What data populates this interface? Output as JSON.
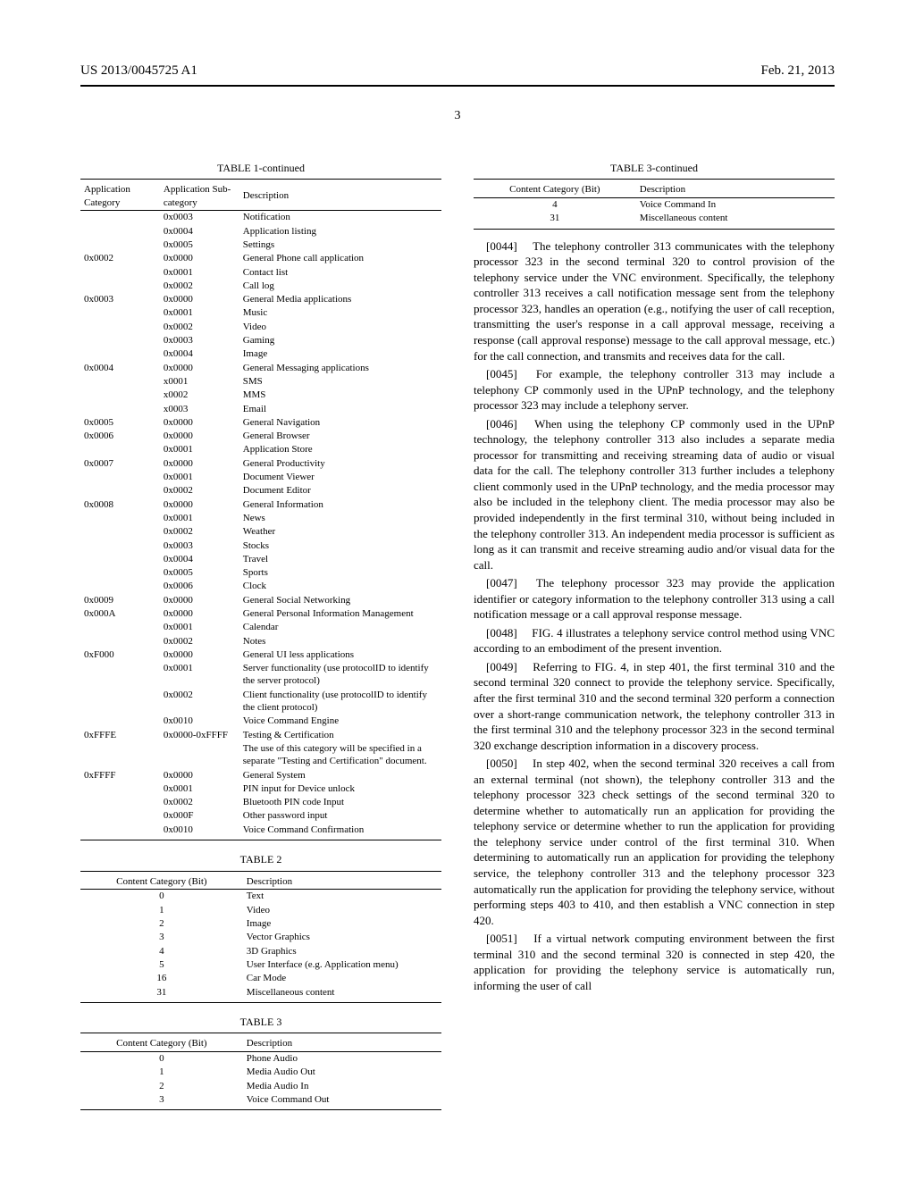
{
  "header": {
    "pub_number": "US 2013/0045725 A1",
    "pub_date": "Feb. 21, 2013",
    "page_number": "3"
  },
  "table1": {
    "title": "TABLE 1-continued",
    "headers": [
      "Application Category",
      "Application Sub-category",
      "Description"
    ],
    "rows": [
      [
        "",
        "0x0003",
        "Notification"
      ],
      [
        "",
        "0x0004",
        "Application listing"
      ],
      [
        "",
        "0x0005",
        "Settings"
      ],
      [
        "0x0002",
        "0x0000",
        "General Phone call application"
      ],
      [
        "",
        "0x0001",
        "Contact list"
      ],
      [
        "",
        "0x0002",
        "Call log"
      ],
      [
        "0x0003",
        "0x0000",
        "General Media applications"
      ],
      [
        "",
        "0x0001",
        "Music"
      ],
      [
        "",
        "0x0002",
        "Video"
      ],
      [
        "",
        "0x0003",
        "Gaming"
      ],
      [
        "",
        "0x0004",
        "Image"
      ],
      [
        "0x0004",
        "0x0000",
        "General Messaging applications"
      ],
      [
        "",
        "x0001",
        "SMS"
      ],
      [
        "",
        "x0002",
        "MMS"
      ],
      [
        "",
        "x0003",
        "Email"
      ],
      [
        "0x0005",
        "0x0000",
        "General Navigation"
      ],
      [
        "0x0006",
        "0x0000",
        "General Browser"
      ],
      [
        "",
        "0x0001",
        "Application Store"
      ],
      [
        "0x0007",
        "0x0000",
        "General Productivity"
      ],
      [
        "",
        "0x0001",
        "Document Viewer"
      ],
      [
        "",
        "0x0002",
        "Document Editor"
      ],
      [
        "0x0008",
        "0x0000",
        "General Information"
      ],
      [
        "",
        "0x0001",
        "News"
      ],
      [
        "",
        "0x0002",
        "Weather"
      ],
      [
        "",
        "0x0003",
        "Stocks"
      ],
      [
        "",
        "0x0004",
        "Travel"
      ],
      [
        "",
        "0x0005",
        "Sports"
      ],
      [
        "",
        "0x0006",
        "Clock"
      ],
      [
        "0x0009",
        "0x0000",
        "General Social Networking"
      ],
      [
        "0x000A",
        "0x0000",
        "General Personal Information Management"
      ],
      [
        "",
        "0x0001",
        "Calendar"
      ],
      [
        "",
        "0x0002",
        "Notes"
      ],
      [
        "0xF000",
        "0x0000",
        "General UI less applications"
      ],
      [
        "",
        "0x0001",
        "Server functionality (use protocolID to identify the server protocol)"
      ],
      [
        "",
        "0x0002",
        "Client functionality (use protocolID to identify the client protocol)"
      ],
      [
        "",
        "0x0010",
        "Voice Command Engine"
      ],
      [
        "0xFFFE",
        "0x0000-0xFFFF",
        "Testing & Certification"
      ],
      [
        "",
        "",
        "The use of this category will be specified in a separate \"Testing and Certification\" document."
      ],
      [
        "0xFFFF",
        "0x0000",
        "General System"
      ],
      [
        "",
        "0x0001",
        "PIN input for Device unlock"
      ],
      [
        "",
        "0x0002",
        "Bluetooth PIN code Input"
      ],
      [
        "",
        "0x000F",
        "Other password input"
      ],
      [
        "",
        "0x0010",
        "Voice Command Confirmation"
      ]
    ]
  },
  "table2": {
    "title": "TABLE 2",
    "headers": [
      "Content Category (Bit)",
      "Description"
    ],
    "rows": [
      [
        "0",
        "Text"
      ],
      [
        "1",
        "Video"
      ],
      [
        "2",
        "Image"
      ],
      [
        "3",
        "Vector Graphics"
      ],
      [
        "4",
        "3D Graphics"
      ],
      [
        "5",
        "User Interface (e.g. Application menu)"
      ],
      [
        "16",
        "Car Mode"
      ],
      [
        "31",
        "Miscellaneous content"
      ]
    ]
  },
  "table3": {
    "title": "TABLE 3",
    "headers": [
      "Content Category (Bit)",
      "Description"
    ],
    "rows": [
      [
        "0",
        "Phone Audio"
      ],
      [
        "1",
        "Media Audio Out"
      ],
      [
        "2",
        "Media Audio In"
      ],
      [
        "3",
        "Voice Command Out"
      ]
    ]
  },
  "table3c": {
    "title": "TABLE 3-continued",
    "headers": [
      "Content Category (Bit)",
      "Description"
    ],
    "rows": [
      [
        "4",
        "Voice Command In"
      ],
      [
        "31",
        "Miscellaneous content"
      ]
    ]
  },
  "paras": {
    "p44": "[0044]  The telephony controller 313 communicates with the telephony processor 323 in the second terminal 320 to control provision of the telephony service under the VNC environment. Specifically, the telephony controller 313 receives a call notification message sent from the telephony processor 323, handles an operation (e.g., notifying the user of call reception, transmitting the user's response in a call approval message, receiving a response (call approval response) message to the call approval message, etc.) for the call connection, and transmits and receives data for the call.",
    "p45": "[0045]  For example, the telephony controller 313 may include a telephony CP commonly used in the UPnP technology, and the telephony processor 323 may include a telephony server.",
    "p46": "[0046]  When using the telephony CP commonly used in the UPnP technology, the telephony controller 313 also includes a separate media processor for transmitting and receiving streaming data of audio or visual data for the call. The telephony controller 313 further includes a telephony client commonly used in the UPnP technology, and the media processor may also be included in the telephony client. The media processor may also be provided independently in the first terminal 310, without being included in the telephony controller 313. An independent media processor is sufficient as long as it can transmit and receive streaming audio and/or visual data for the call.",
    "p47": "[0047]  The telephony processor 323 may provide the application identifier or category information to the telephony controller 313 using a call notification message or a call approval response message.",
    "p48": "[0048]  FIG. 4 illustrates a telephony service control method using VNC according to an embodiment of the present invention.",
    "p49": "[0049]  Referring to FIG. 4, in step 401, the first terminal 310 and the second terminal 320 connect to provide the telephony service. Specifically, after the first terminal 310 and the second terminal 320 perform a connection over a short-range communication network, the telephony controller 313 in the first terminal 310 and the telephony processor 323 in the second terminal 320 exchange description information in a discovery process.",
    "p50": "[0050]  In step 402, when the second terminal 320 receives a call from an external terminal (not shown), the telephony controller 313 and the telephony processor 323 check settings of the second terminal 320 to determine whether to automatically run an application for providing the telephony service or determine whether to run the application for providing the telephony service under control of the first terminal 310. When determining to automatically run an application for providing the telephony service, the telephony controller 313 and the telephony processor 323 automatically run the application for providing the telephony service, without performing steps 403 to 410, and then establish a VNC connection in step 420.",
    "p51": "[0051]  If a virtual network computing environment between the first terminal 310 and the second terminal 320 is connected in step 420, the application for providing the telephony service is automatically run, informing the user of call"
  }
}
